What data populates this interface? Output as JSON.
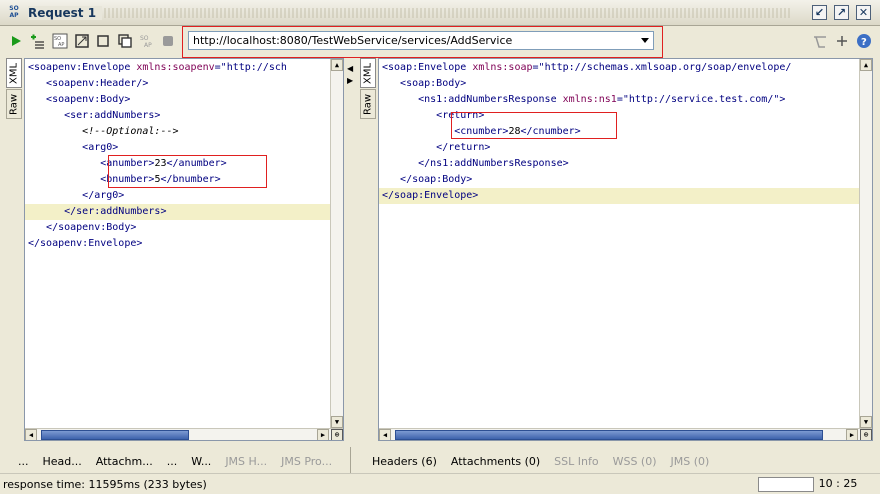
{
  "window": {
    "title": "Request 1",
    "logo_text": "SOAP"
  },
  "toolbar": {
    "url": "http://localhost:8080/TestWebService/services/AddService"
  },
  "request": {
    "tabs": [
      "XML",
      "Raw"
    ],
    "lines": [
      {
        "segments": [
          {
            "c": "tag",
            "t": "<soapenv:Envelope "
          },
          {
            "c": "attr",
            "t": "xmlns:soapenv"
          },
          {
            "c": "tag",
            "t": "=\"http://sch"
          }
        ]
      },
      {
        "segments": [
          {
            "c": "tag",
            "t": "   <soapenv:Header/>"
          }
        ]
      },
      {
        "segments": [
          {
            "c": "tag",
            "t": "   <soapenv:Body>"
          }
        ]
      },
      {
        "segments": [
          {
            "c": "tag",
            "t": "      <ser:addNumbers>"
          }
        ]
      },
      {
        "segments": [
          {
            "c": "cmt",
            "t": "         <!--Optional:-->"
          }
        ]
      },
      {
        "segments": [
          {
            "c": "tag",
            "t": "         <arg0>"
          }
        ]
      },
      {
        "segments": [
          {
            "c": "tag",
            "t": "            <anumber>"
          },
          {
            "c": "plain",
            "t": "23"
          },
          {
            "c": "tag",
            "t": "</anumber>"
          }
        ]
      },
      {
        "segments": [
          {
            "c": "tag",
            "t": "            <bnumber>"
          },
          {
            "c": "plain",
            "t": "5"
          },
          {
            "c": "tag",
            "t": "</bnumber>"
          }
        ]
      },
      {
        "segments": [
          {
            "c": "tag",
            "t": "         </arg0>"
          }
        ]
      },
      {
        "segments": [
          {
            "c": "tag",
            "t": "      </ser:addNumbers>"
          }
        ],
        "highlight": true
      },
      {
        "segments": [
          {
            "c": "tag",
            "t": "   </soapenv:Body>"
          }
        ]
      },
      {
        "segments": [
          {
            "c": "tag",
            "t": "</soapenv:Envelope>"
          }
        ]
      }
    ],
    "bottom_tabs": [
      "...",
      "Head...",
      "Attachm...",
      "...",
      "W...",
      "JMS H...",
      "JMS Pro..."
    ]
  },
  "response": {
    "tabs": [
      "XML",
      "Raw"
    ],
    "lines": [
      {
        "segments": [
          {
            "c": "tag",
            "t": "<soap:Envelope "
          },
          {
            "c": "attr",
            "t": "xmlns:soap"
          },
          {
            "c": "tag",
            "t": "=\"http://schemas.xmlsoap.org/soap/envelope/"
          }
        ]
      },
      {
        "segments": [
          {
            "c": "tag",
            "t": "   <soap:Body>"
          }
        ]
      },
      {
        "segments": [
          {
            "c": "tag",
            "t": "      <ns1:addNumbersResponse "
          },
          {
            "c": "attr",
            "t": "xmlns:ns1"
          },
          {
            "c": "tag",
            "t": "=\"http://service.test.com/\">"
          }
        ]
      },
      {
        "segments": [
          {
            "c": "tag",
            "t": "         <return>"
          }
        ]
      },
      {
        "segments": [
          {
            "c": "tag",
            "t": "            <cnumber>"
          },
          {
            "c": "plain",
            "t": "28"
          },
          {
            "c": "tag",
            "t": "</cnumber>"
          }
        ]
      },
      {
        "segments": [
          {
            "c": "tag",
            "t": "         </return>"
          }
        ]
      },
      {
        "segments": [
          {
            "c": "tag",
            "t": "      </ns1:addNumbersResponse>"
          }
        ]
      },
      {
        "segments": [
          {
            "c": "tag",
            "t": "   </soap:Body>"
          }
        ]
      },
      {
        "segments": [
          {
            "c": "tag",
            "t": "</soap:Envelope>"
          }
        ],
        "highlight": true
      }
    ],
    "bottom_tabs": [
      {
        "label": "Headers (6)",
        "enabled": true
      },
      {
        "label": "Attachments (0)",
        "enabled": true
      },
      {
        "label": "SSL Info",
        "enabled": false
      },
      {
        "label": "WSS (0)",
        "enabled": false
      },
      {
        "label": "JMS (0)",
        "enabled": false
      }
    ]
  },
  "status": {
    "response_time": "response time: 11595ms (233 bytes)",
    "cursor_position": "10 : 25"
  },
  "colors": {
    "tag": "#000080",
    "attr": "#7f0055",
    "highlight": "#f3f0c8",
    "annotation": "#e02020",
    "run_icon": "#1a9a1a"
  }
}
